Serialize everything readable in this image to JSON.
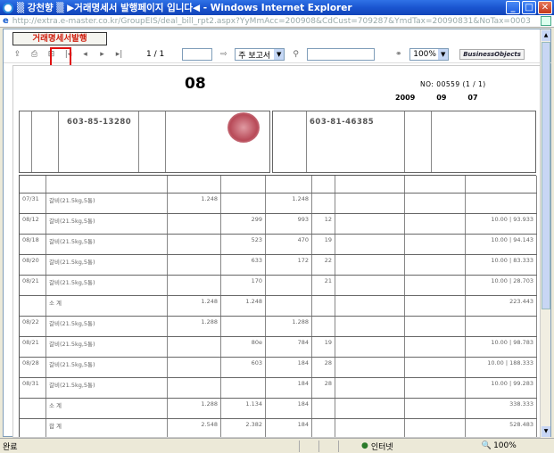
{
  "window": {
    "title": "▒ 강천향 ▒ ▶거래명세서 발행페이지 입니다◀ - Windows Internet Explorer",
    "address": "http://extra.e-master.co.kr/GroupEIS/deal_bill_rpt2.aspx?YyMmAcc=200908&CdCust=709287&YmdTax=20090831&NoTax=0003",
    "address_host": "e-master.co.kr",
    "minimize": "_",
    "maximize": "□",
    "close": "✕"
  },
  "report_button": "거래명세서발행",
  "toolbar": {
    "page": "1 / 1",
    "view_select": "주 보고서",
    "zoom": "100%",
    "logo": "BusinessObjects"
  },
  "document": {
    "number": "08",
    "no_label": "NO: 00559 (1 / 1)",
    "year": "2009",
    "month": "09",
    "day": "07",
    "supplier_regno": "603-85-13280",
    "buyer_regno": "603-81-46385"
  },
  "table_rows": [
    {
      "date": "07/31",
      "item": "갈비(21.5kg,5통)",
      "q1": "1.248",
      "q2": "",
      "q3": "1.248",
      "n": "",
      "total": ""
    },
    {
      "date": "08/12",
      "item": "갈비(21.5kg,5통)",
      "q1": "",
      "q2": "299",
      "q3": "993",
      "n": "12",
      "total": "10.00 | 93.933"
    },
    {
      "date": "08/18",
      "item": "갈비(21.5kg,5통)",
      "q1": "",
      "q2": "523",
      "q3": "470",
      "n": "19",
      "total": "10.00 | 94.143"
    },
    {
      "date": "08/20",
      "item": "갈비(21.5kg,5통)",
      "q1": "",
      "q2": "633",
      "q3": "172",
      "n": "22",
      "total": "10.00 | 83.333"
    },
    {
      "date": "08/21",
      "item": "갈비(21.5kg,5통)",
      "q1": "",
      "q2": "170",
      "q3": "",
      "n": "21",
      "total": "10.00 | 28.703"
    },
    {
      "date": "",
      "item": "소 계",
      "q1": "1.248",
      "q2": "1.248",
      "q3": "",
      "n": "",
      "total": "223.443"
    },
    {
      "date": "08/22",
      "item": "갈비(21.5kg,5통)",
      "q1": "1.288",
      "q2": "",
      "q3": "1.288",
      "n": "",
      "total": ""
    },
    {
      "date": "08/21",
      "item": "갈비(21.5kg,5통)",
      "q1": "",
      "q2": "80e",
      "q3": "784",
      "n": "19",
      "total": "10.00 | 98.783"
    },
    {
      "date": "08/28",
      "item": "갈비(21.5kg,5통)",
      "q1": "",
      "q2": "603",
      "q3": "184",
      "n": "28",
      "total": "10.00 | 188.333"
    },
    {
      "date": "08/31",
      "item": "갈비(21.5kg,5통)",
      "q1": "",
      "q2": "",
      "q3": "184",
      "n": "28",
      "total": "10.00 | 99.283"
    },
    {
      "date": "",
      "item": "소 계",
      "q1": "1.288",
      "q2": "1.134",
      "q3": "184",
      "n": "",
      "total": "338.333"
    },
    {
      "date": "",
      "item": "합 계",
      "q1": "2.548",
      "q2": "2.382",
      "q3": "184",
      "n": "",
      "total": "528.483"
    }
  ],
  "status": {
    "left": "완료",
    "zone": "인터넷",
    "zoom": "100%"
  }
}
